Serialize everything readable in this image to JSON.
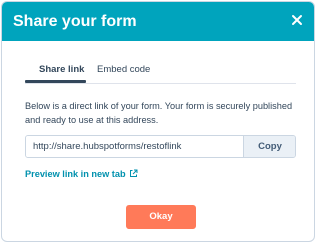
{
  "modal": {
    "title": "Share your form",
    "close_icon": "close-icon"
  },
  "tabs": [
    {
      "label": "Share link",
      "active": true
    },
    {
      "label": "Embed code",
      "active": false
    }
  ],
  "description": "Below is a direct link of your form. Your form is securely published and ready to use at this address.",
  "link_field": {
    "value": "http://share.hubspotforms/restoflink",
    "copy_label": "Copy"
  },
  "preview_link": {
    "label": "Preview link in new tab",
    "icon": "external-link-icon"
  },
  "footer": {
    "okay_label": "Okay"
  },
  "colors": {
    "header": "#00a4bd",
    "primary_button": "#ff7a59",
    "link": "#0091ae",
    "text": "#33475b"
  }
}
